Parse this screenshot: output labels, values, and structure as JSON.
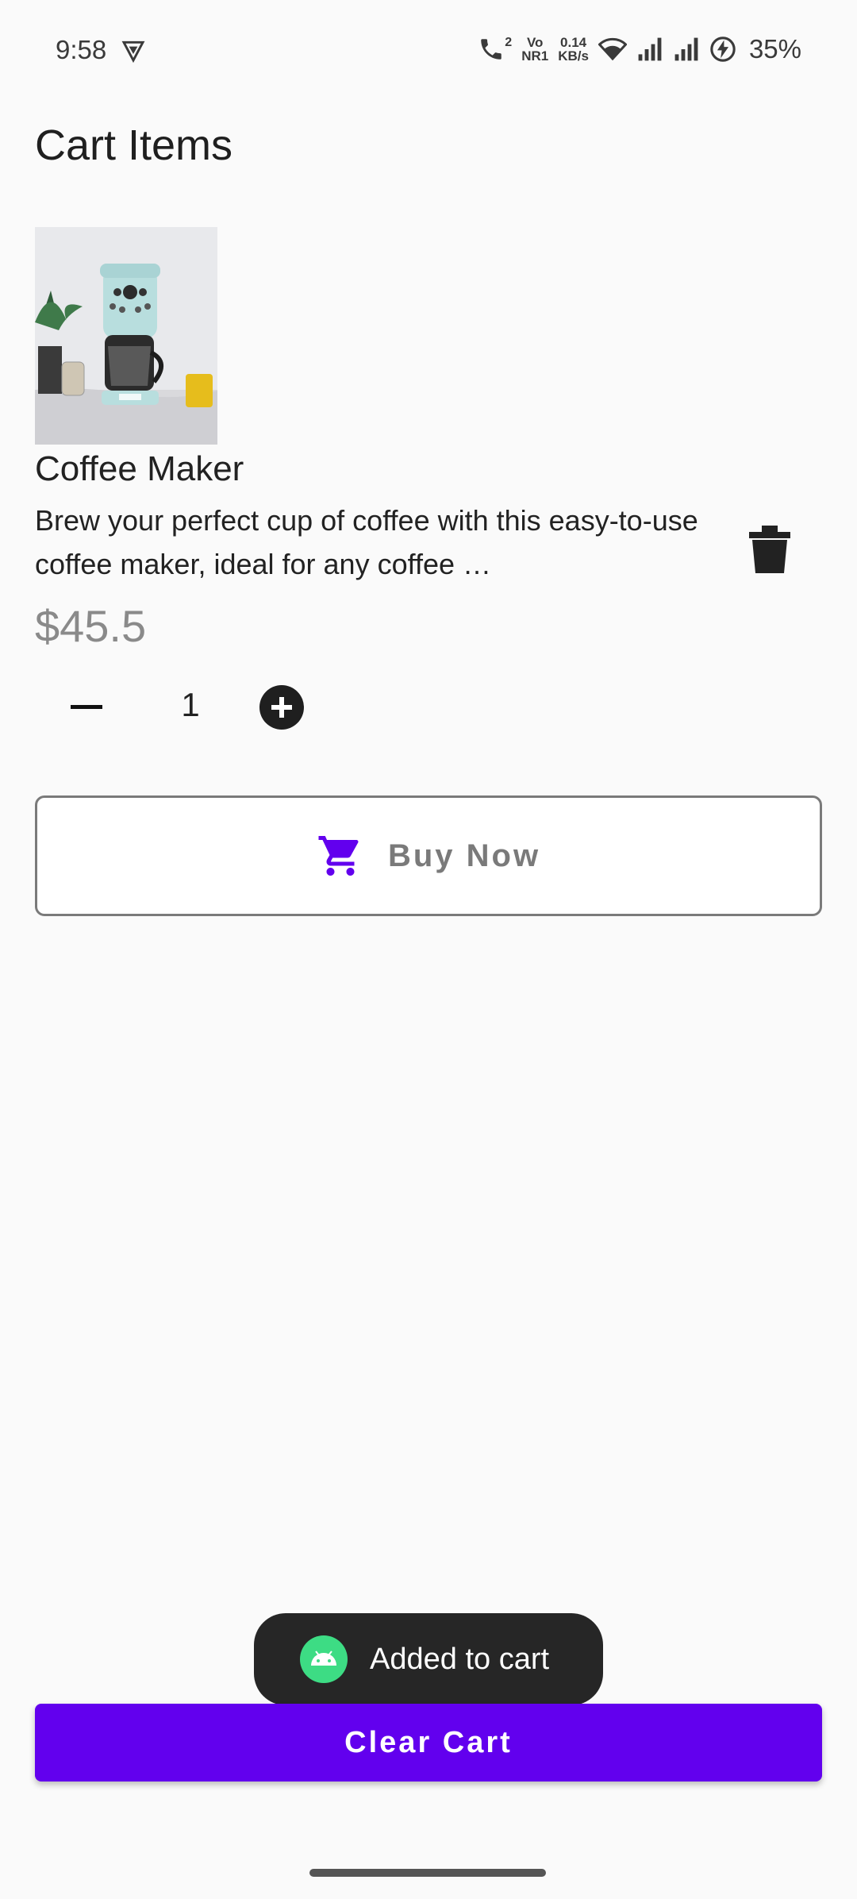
{
  "status_bar": {
    "time": "9:58",
    "call_badge": "2",
    "vo_label": "Vo",
    "nr_label": "NR1",
    "net_speed": "0.14",
    "net_unit": "KB/s",
    "battery": "35%",
    "icons": [
      "vpn-icon",
      "wifi-calling-icon",
      "wifi-icon",
      "signal-icon",
      "signal-icon",
      "battery-charging-icon"
    ]
  },
  "page": {
    "title": "Cart Items"
  },
  "cart_item": {
    "name": "Coffee Maker",
    "description": "Brew your perfect cup of coffee with this easy-to-use coffee maker, ideal for any coffee …",
    "price": "$45.5",
    "quantity": "1"
  },
  "buy_now": {
    "label": "Buy Now",
    "icon": "cart-icon",
    "icon_color": "#6200ee"
  },
  "toast": {
    "message": "Added to cart",
    "icon": "android-icon"
  },
  "clear_cart": {
    "label": "Clear Cart",
    "color": "#6200ee"
  },
  "colors": {
    "accent": "#6200ee",
    "price": "#8a8a8a",
    "background": "#fafafa"
  }
}
